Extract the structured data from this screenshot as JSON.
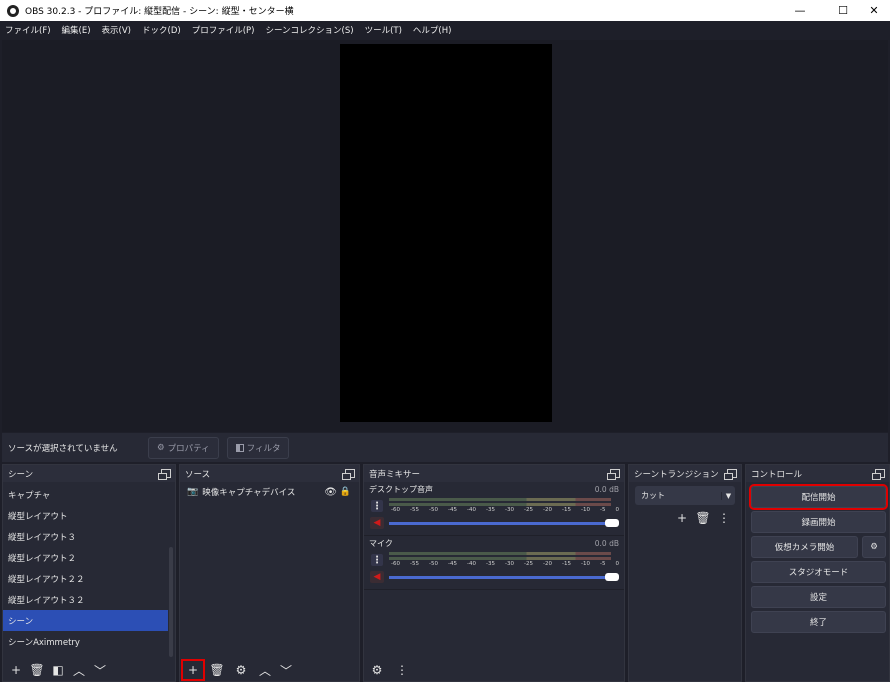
{
  "window": {
    "title": "OBS 30.2.3 - プロファイル: 縦型配信 - シーン: 縦型・センター横",
    "minimize": "—",
    "maximize": "☐",
    "close": "✕"
  },
  "menu": [
    "ファイル(F)",
    "編集(E)",
    "表示(V)",
    "ドック(D)",
    "プロファイル(P)",
    "シーンコレクション(S)",
    "ツール(T)",
    "ヘルプ(H)"
  ],
  "status": {
    "no_source": "ソースが選択されていません",
    "properties": "プロパティ",
    "filters": "フィルタ"
  },
  "scenes": {
    "title": "シーン",
    "items": [
      "キャプチャ",
      "縦型レイアウト",
      "縦型レイアウト３",
      "縦型レイアウト２",
      "縦型レイアウト２２",
      "縦型レイアウト３２",
      "シーン",
      "シーンAximmetry"
    ],
    "active_index": 6
  },
  "sources": {
    "title": "ソース",
    "items": [
      {
        "label": "映像キャプチャデバイス"
      }
    ]
  },
  "mixer": {
    "title": "音声ミキサー",
    "scale": [
      "-60",
      "-55",
      "-50",
      "-45",
      "-40",
      "-35",
      "-30",
      "-25",
      "-20",
      "-15",
      "-10",
      "-5",
      "0"
    ],
    "channels": [
      {
        "name": "デスクトップ音声",
        "db": "0.0 dB",
        "volume": 1.0
      },
      {
        "name": "マイク",
        "db": "0.0 dB",
        "volume": 1.0
      }
    ]
  },
  "transitions": {
    "title": "シーントランジション",
    "selected": "カット"
  },
  "controls": {
    "title": "コントロール",
    "start_stream": "配信開始",
    "start_record": "録画開始",
    "virtual_cam": "仮想カメラ開始",
    "studio_mode": "スタジオモード",
    "settings": "設定",
    "exit": "終了"
  },
  "colors": {
    "highlight": "#e00000",
    "active_scene": "#2c4fb5",
    "volume_slider": "#4a6ad0"
  }
}
